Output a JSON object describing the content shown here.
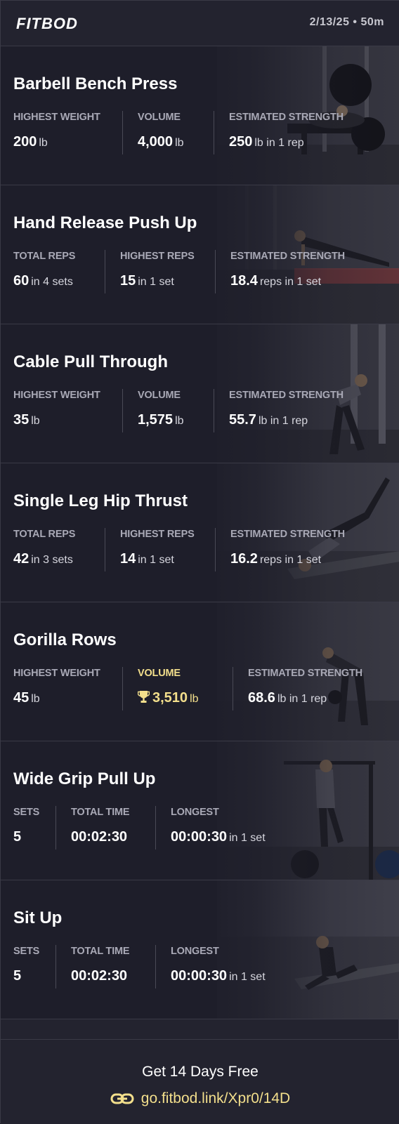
{
  "header": {
    "logo": "FITBOD",
    "date_duration": "2/13/25 • 50m"
  },
  "exercises": [
    {
      "title": "Barbell Bench Press",
      "stats": [
        {
          "label": "HIGHEST WEIGHT",
          "value": "200",
          "unit": "lb"
        },
        {
          "label": "VOLUME",
          "value": "4,000",
          "unit": "lb"
        },
        {
          "label": "ESTIMATED STRENGTH",
          "value": "250",
          "unit": "lb in 1 rep"
        }
      ]
    },
    {
      "title": "Hand Release Push Up",
      "stats": [
        {
          "label": "TOTAL REPS",
          "value": "60",
          "unit": "in 4 sets"
        },
        {
          "label": "HIGHEST REPS",
          "value": "15",
          "unit": "in 1 set"
        },
        {
          "label": "ESTIMATED STRENGTH",
          "value": "18.4",
          "unit": "reps in 1 set"
        }
      ]
    },
    {
      "title": "Cable Pull Through",
      "stats": [
        {
          "label": "HIGHEST WEIGHT",
          "value": "35",
          "unit": "lb"
        },
        {
          "label": "VOLUME",
          "value": "1,575",
          "unit": "lb"
        },
        {
          "label": "ESTIMATED STRENGTH",
          "value": "55.7",
          "unit": "lb in 1 rep"
        }
      ]
    },
    {
      "title": "Single Leg Hip Thrust",
      "stats": [
        {
          "label": "TOTAL REPS",
          "value": "42",
          "unit": "in 3 sets"
        },
        {
          "label": "HIGHEST REPS",
          "value": "14",
          "unit": "in 1 set"
        },
        {
          "label": "ESTIMATED STRENGTH",
          "value": "16.2",
          "unit": "reps in 1 set"
        }
      ]
    },
    {
      "title": "Gorilla Rows",
      "stats": [
        {
          "label": "HIGHEST WEIGHT",
          "value": "45",
          "unit": "lb"
        },
        {
          "label": "VOLUME",
          "value": "3,510",
          "unit": "lb",
          "highlight": "trophy"
        },
        {
          "label": "ESTIMATED STRENGTH",
          "value": "68.6",
          "unit": "lb in 1 rep"
        }
      ]
    },
    {
      "title": "Wide Grip Pull Up",
      "stats": [
        {
          "label": "SETS",
          "value": "5",
          "unit": ""
        },
        {
          "label": "TOTAL TIME",
          "value": "00:02:30",
          "unit": ""
        },
        {
          "label": "LONGEST",
          "value": "00:00:30",
          "unit": "in 1 set"
        }
      ]
    },
    {
      "title": "Sit Up",
      "stats": [
        {
          "label": "SETS",
          "value": "5",
          "unit": ""
        },
        {
          "label": "TOTAL TIME",
          "value": "00:02:30",
          "unit": ""
        },
        {
          "label": "LONGEST",
          "value": "00:00:30",
          "unit": "in 1 set"
        }
      ]
    }
  ],
  "footer": {
    "cta": "Get 14 Days Free",
    "link": "go.fitbod.link/Xpr0/14D"
  },
  "colors": {
    "highlight": "#f3df8c",
    "background": "#1e1e2a",
    "label": "#a9a9b6"
  },
  "icons": {
    "pr": "trophy-icon",
    "link": "link-icon"
  }
}
